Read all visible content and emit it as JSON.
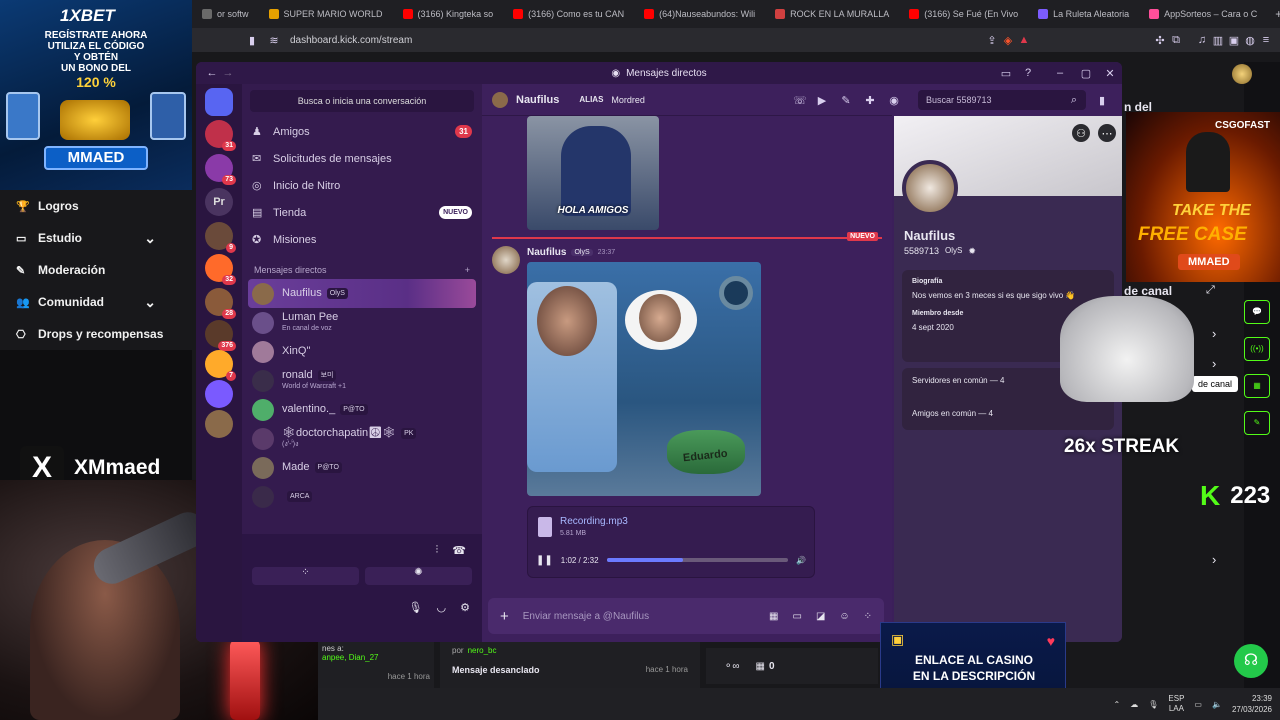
{
  "browser": {
    "tabs": [
      {
        "label": "or softw",
        "color": "#6a6a6a"
      },
      {
        "label": "SUPER MARIO WORLD",
        "color": "#e6a100"
      },
      {
        "label": "(3166) Kingteka so",
        "color": "#ff0000"
      },
      {
        "label": "(3166) Como es tu CAN",
        "color": "#ff0000"
      },
      {
        "label": "(64)Nauseabundos: Wili",
        "color": "#ff0000"
      },
      {
        "label": "ROCK EN LA MURALLA",
        "color": "#d04040"
      },
      {
        "label": "(3166) Se Fué (En Vivo",
        "color": "#ff0000"
      },
      {
        "label": "La Ruleta Aleatoria",
        "color": "#7c5cff"
      },
      {
        "label": "AppSorteos – Cara o C",
        "color": "#ff4f9a"
      }
    ],
    "new_tab": "+",
    "url": "dashboard.kick.com/stream"
  },
  "ad": {
    "brand": "1XBET",
    "line1": "REGÍSTRATE AHORA",
    "line2": "UTILIZA EL CÓDIGO",
    "line3": "Y OBTÉN",
    "line4": "UN BONO DEL",
    "bonus": "120 %",
    "code": "MMAED"
  },
  "kick_nav": [
    {
      "label": "Logros",
      "icon": "trophy-icon",
      "chevron": false
    },
    {
      "label": "Estudio",
      "icon": "studio-icon",
      "chevron": true
    },
    {
      "label": "Moderación",
      "icon": "wrench-icon",
      "chevron": false
    },
    {
      "label": "Comunidad",
      "icon": "community-icon",
      "chevron": true
    },
    {
      "label": "Drops y recompensas",
      "icon": "drops-icon",
      "chevron": false
    }
  ],
  "x_badge": "XMmaed",
  "discord": {
    "title": "Mensajes directos",
    "search_placeholder": "Busca o inicia una conversación",
    "nav": [
      {
        "label": "Amigos",
        "badge": "31",
        "icon": "friends-icon"
      },
      {
        "label": "Solicitudes de mensajes",
        "badge": "",
        "icon": "mail-icon"
      },
      {
        "label": "Inicio de Nitro",
        "badge": "",
        "icon": "nitro-icon"
      },
      {
        "label": "Tienda",
        "badge": "NUEVO",
        "icon": "shop-icon"
      },
      {
        "label": "Misiones",
        "badge": "",
        "icon": "quest-icon"
      }
    ],
    "dm_header": "Mensajes directos",
    "dm_add": "+",
    "dms": [
      {
        "name": "Naufilus",
        "sub": "",
        "tag": "OlyS",
        "color": "#8a6a4a",
        "active": true
      },
      {
        "name": "Luman Pee",
        "sub": "En canal de voz",
        "tag": "",
        "color": "#6a4f8a",
        "active": false
      },
      {
        "name": "XinQ\"",
        "sub": "",
        "tag": "",
        "color": "#a07a9a",
        "active": false
      },
      {
        "name": "ronald",
        "sub": "World of Warcraft +1",
        "tag": "보미",
        "color": "#3a2d4a",
        "active": false
      },
      {
        "name": "valentino._",
        "sub": "",
        "tag": "P@TO",
        "color": "#4fae6a",
        "active": false
      },
      {
        "name": "🕸doctorchapatin☮🕸",
        "sub": "(ง'̀-'́)ง",
        "tag": "PK",
        "color": "#5a3a6a",
        "active": false
      },
      {
        "name": "Made",
        "sub": "",
        "tag": "P@TO",
        "color": "#7a6a5a",
        "active": false
      },
      {
        "name": "",
        "sub": "",
        "tag": "ARCA",
        "color": "#3a2a4a",
        "active": false
      }
    ],
    "server_badges": [
      "31",
      "73",
      "Pr",
      "9",
      "32",
      "28",
      "376",
      "7",
      "2"
    ],
    "chat_header": {
      "name": "Naufilus",
      "alias_label": "ALIAS",
      "alias": "Mordred",
      "search_placeholder": "Buscar 5589713"
    },
    "image1_caption": "HOLA AMIGOS",
    "new_divider": "NUEVO",
    "message": {
      "author": "Naufilus",
      "tag": "OlyS",
      "time": "23:37",
      "image_caption": "Eduardo"
    },
    "attachment": {
      "file": "Recording.mp3",
      "size": "5.81 MB",
      "time": "1:02 / 2:32",
      "progress": 0.42
    },
    "composer_placeholder": "Enviar mensaje a @Naufilus",
    "profile": {
      "name": "Naufilus",
      "id": "5589713",
      "tag": "OlyS",
      "bio_label": "Biografía",
      "bio": "Nos vemos en 3 meces si es que sigo vivo 👋",
      "member_label": "Miembro desde",
      "member_since": "4 sept 2020",
      "servers_common": "Servidores en común — 4",
      "friends_common": "Amigos en común — 4"
    }
  },
  "overlay": {
    "streak": "26x STREAK",
    "kick_count": "223",
    "csgofast": "CSGOFAST",
    "free_case_1": "TAKE THE",
    "free_case_2": "FREE CASE",
    "free_case_code": "MMAED",
    "casino_1": "ENLACE AL CASINO",
    "casino_2": "EN LA DESCRIPCIÓN",
    "right_text_top": "n del",
    "right_text_mid": "de canal",
    "tooltip": "de canal"
  },
  "background_chat": {
    "line1": "nes a:",
    "line2": "anpee, Dian_27",
    "time1": "hace 1 hora",
    "pin_msg": "Mensaje desanclado",
    "pin_time": "hace 1 hora",
    "by": "por",
    "by_user": "nero_bc",
    "counter": "0"
  },
  "taskbar": {
    "lang1": "ESP",
    "lang2": "LAA",
    "time": "23:39",
    "date": "27/03/2026"
  }
}
